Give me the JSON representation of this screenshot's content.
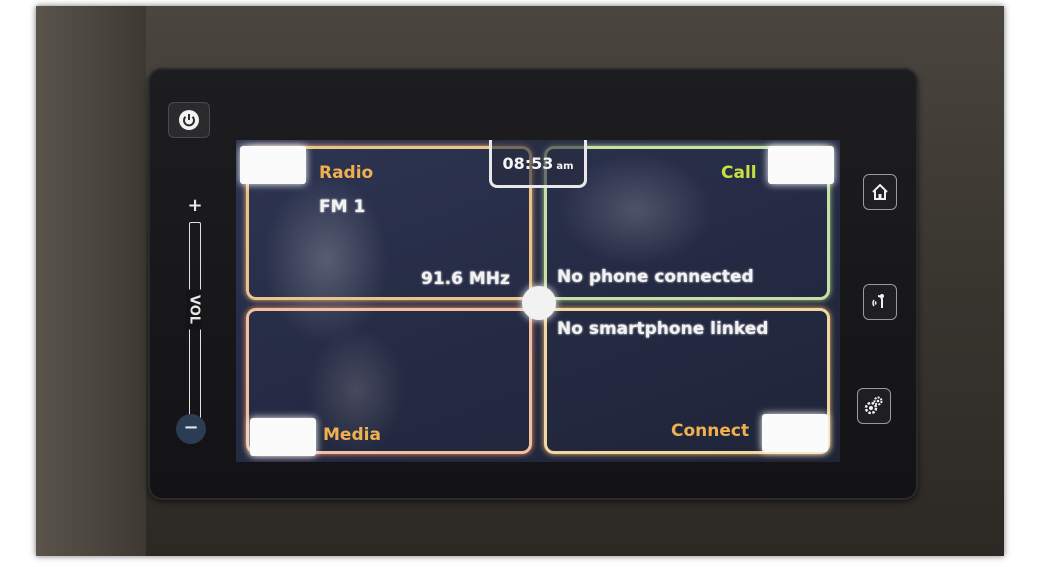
{
  "screen": {
    "clock": {
      "time": "08:53",
      "ampm": "am"
    },
    "tiles": {
      "radio": {
        "title": "Radio",
        "band": "FM 1",
        "frequency": "91.6 MHz"
      },
      "call": {
        "title": "Call",
        "status": "No phone connected"
      },
      "media": {
        "title": "Media"
      },
      "connect": {
        "title": "Connect",
        "status": "No smartphone linked"
      }
    }
  },
  "volume": {
    "plus": "+",
    "label": "VOL",
    "minus": "−"
  },
  "side_buttons": [
    "home-icon",
    "voice-call-icon",
    "settings-gear-icon"
  ],
  "power_icon": "power-icon",
  "colors": {
    "radio_accent": "#f0b050",
    "call_accent": "#c8e040",
    "media_accent": "#f0b050",
    "connect_accent": "#f0b050"
  }
}
